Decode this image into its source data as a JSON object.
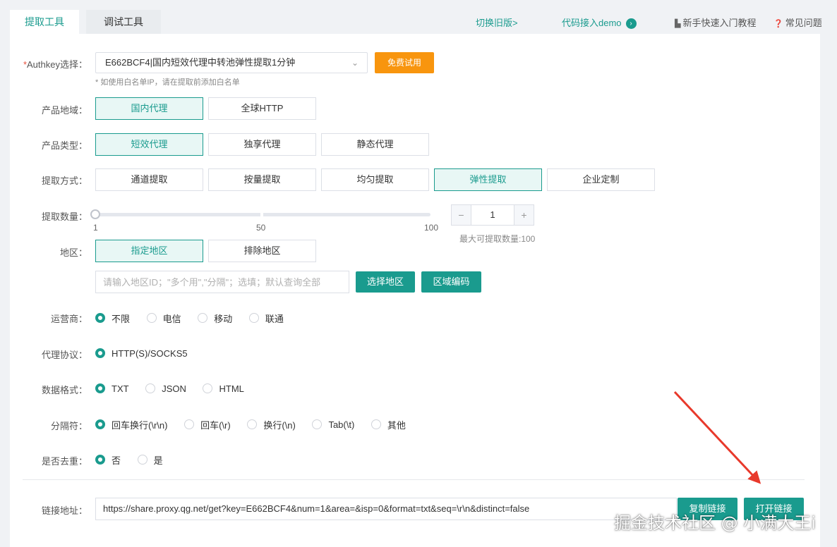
{
  "tabs": [
    {
      "label": "提取工具",
      "active": true
    },
    {
      "label": "调试工具",
      "active": false
    }
  ],
  "top_links": {
    "switch_old": "切换旧版>",
    "code_demo": "代码接入demo",
    "tutorial": "新手快速入门教程",
    "faq": "常见问题"
  },
  "authkey": {
    "label": "Authkey选择：",
    "required_mark": "*",
    "selected": "E662BCF4|国内短效代理中转池弹性提取1分钟",
    "free_trial": "免费试用",
    "hint": "* 如使用白名单IP，请在提取前添加白名单"
  },
  "region": {
    "label": "产品地域：",
    "options": [
      "国内代理",
      "全球HTTP"
    ],
    "selected": "国内代理"
  },
  "product_type": {
    "label": "产品类型：",
    "options": [
      "短效代理",
      "独享代理",
      "静态代理"
    ],
    "selected": "短效代理"
  },
  "extract_method": {
    "label": "提取方式：",
    "options": [
      "通道提取",
      "按量提取",
      "均匀提取",
      "弹性提取",
      "企业定制"
    ],
    "selected": "弹性提取"
  },
  "quantity": {
    "label": "提取数量：",
    "min_label": "1",
    "mid_label": "50",
    "max_label": "100",
    "value": "1",
    "value_fraction": 0,
    "minus": "−",
    "plus": "+",
    "max_note": "最大可提取数量:100"
  },
  "area": {
    "label": "地区：",
    "options": [
      "指定地区",
      "排除地区"
    ],
    "selected": "指定地区",
    "placeholder": "请输入地区ID；\"多个用\",\"分隔\"；选填；默认查询全部",
    "choose_button": "选择地区",
    "code_button": "区域编码"
  },
  "isp": {
    "label": "运营商：",
    "options": [
      "不限",
      "电信",
      "移动",
      "联通"
    ],
    "selected": "不限"
  },
  "protocol": {
    "label": "代理协议：",
    "options": [
      "HTTP(S)/SOCKS5"
    ],
    "selected": "HTTP(S)/SOCKS5"
  },
  "format": {
    "label": "数据格式：",
    "options": [
      "TXT",
      "JSON",
      "HTML"
    ],
    "selected": "TXT"
  },
  "separator": {
    "label": "分隔符：",
    "options": [
      "回车换行(\\r\\n)",
      "回车(\\r)",
      "换行(\\n)",
      "Tab(\\t)",
      "其他"
    ],
    "selected": "回车换行(\\r\\n)"
  },
  "dedupe": {
    "label": "是否去重：",
    "options": [
      "否",
      "是"
    ],
    "selected": "否"
  },
  "link": {
    "label": "链接地址：",
    "url": "https://share.proxy.qg.net/get?key=E662BCF4&num=1&area=&isp=0&format=txt&seq=\\r\\n&distinct=false",
    "copy_button": "复制链接",
    "open_button": "打开链接"
  },
  "watermark": "掘金技术社区 @ 小满大王i",
  "colors": {
    "accent": "#1a9b8e",
    "orange": "#f8950e",
    "arrow": "#e8392b"
  },
  "icons": {
    "dropdown": "chevron-down-icon",
    "demo": "arrow-right-circle-icon",
    "tutorial": "book-icon",
    "faq": "question-chat-icon"
  }
}
